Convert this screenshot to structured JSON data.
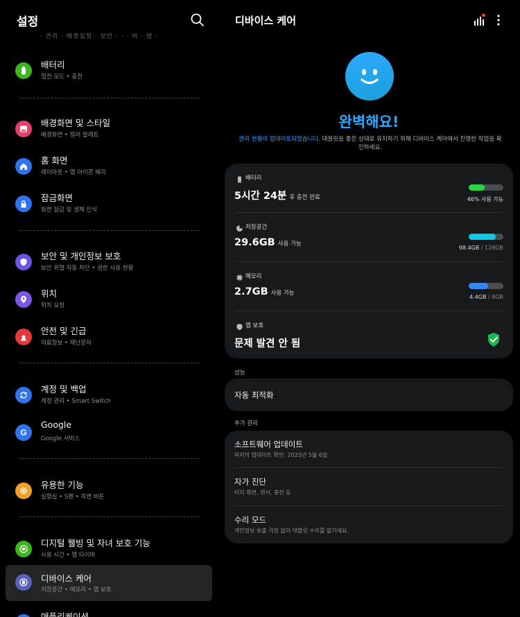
{
  "left": {
    "title": "설정",
    "cut_line": "· 관리 · 배경설정 · 보안 · · · 비 · 방 ·",
    "items": [
      {
        "title": "배터리",
        "sub": "절전 모드 • 충전",
        "icon": "battery-icon",
        "color": "#3bb61e"
      },
      {
        "title": "배경화면 및 스타일",
        "sub": "배경화면 • 컬러 팔레트",
        "icon": "wallpaper-icon",
        "color": "#e6416b"
      },
      {
        "title": "홈 화면",
        "sub": "레이아웃 • 앱 아이콘 배지",
        "icon": "home-icon",
        "color": "#2f74ee"
      },
      {
        "title": "잠금화면",
        "sub": "화면 잠금 및 생체 인식",
        "icon": "lock-icon",
        "color": "#2f74ee"
      },
      {
        "title": "보안 및 개인정보 보호",
        "sub": "보안 위협 자동 차단 • 권한 사용 현황",
        "icon": "shield-icon",
        "color": "#6c55e4"
      },
      {
        "title": "위치",
        "sub": "위치 요청",
        "icon": "location-pin-icon",
        "color": "#7a55e6"
      },
      {
        "title": "안전 및 긴급",
        "sub": "의료정보 • 재난문자",
        "icon": "emergency-icon",
        "color": "#e63a3a"
      },
      {
        "title": "계정 및 백업",
        "sub": "계정 관리 • Smart Switch",
        "icon": "sync-icon",
        "color": "#2f74ee"
      },
      {
        "title": "Google",
        "sub": "Google 서비스",
        "icon": "google-icon",
        "color": "#2f74ee"
      },
      {
        "title": "유용한 기능",
        "sub": "실험실 • S펜 • 측면 버튼",
        "icon": "gear-plus-icon",
        "color": "#f0a225"
      },
      {
        "title": "디지털 웰빙 및 자녀 보호 기능",
        "sub": "사용 시간 • 앱 타이머",
        "icon": "heart-icon",
        "color": "#3bb61e"
      },
      {
        "title": "디바이스 케어",
        "sub": "저장공간 • 메모리 • 앱 보호",
        "icon": "device-care-icon",
        "color": "#5a61b8"
      },
      {
        "title": "애플리케이션",
        "sub": "",
        "icon": "apps-icon",
        "color": "#2f74ee"
      }
    ]
  },
  "right": {
    "title": "디바이스 케어",
    "status_title": "완벽해요!",
    "status_link": "관리 현황이 업데이트되었습니다.",
    "status_text": " 태블릿을 좋은 상태로 유지하기 위해 디바이스 케어에서 진행한 작업을 확인하세요.",
    "battery": {
      "label": "배터리",
      "value": "5시간 24분",
      "suffix": "후 충전 완료",
      "percent": 46,
      "caption": "46% 사용 가능",
      "color": "#2fd23f"
    },
    "storage": {
      "label": "저장공간",
      "value": "29.6GB",
      "suffix": "사용 가능",
      "used": "98.4GB",
      "total": " / 128GB",
      "ratio": 0.77,
      "color": "#13c7e6"
    },
    "memory": {
      "label": "메모리",
      "value": "2.7GB",
      "suffix": "사용 가능",
      "used": "4.4GB",
      "total": " / 8GB",
      "ratio": 0.55,
      "color": "#3486f0"
    },
    "app_protect": {
      "label": "앱 보호",
      "value": "문제 발견 안 됨"
    },
    "perf_section": "성능",
    "auto_opt": "자동 최적화",
    "extra_section": "추가 관리",
    "software_update": {
      "title": "소프트웨어 업데이트",
      "sub": "마지막 업데이트 확인: 2025년 5월 6일"
    },
    "self_diag": {
      "title": "자가 진단",
      "sub": "터치 화면, 센서, 충전 등"
    },
    "repair_mode": {
      "title": "수리 모드",
      "sub": "개인정보 유출 걱정 없이 태블릿 수리를 맡기세요."
    }
  }
}
